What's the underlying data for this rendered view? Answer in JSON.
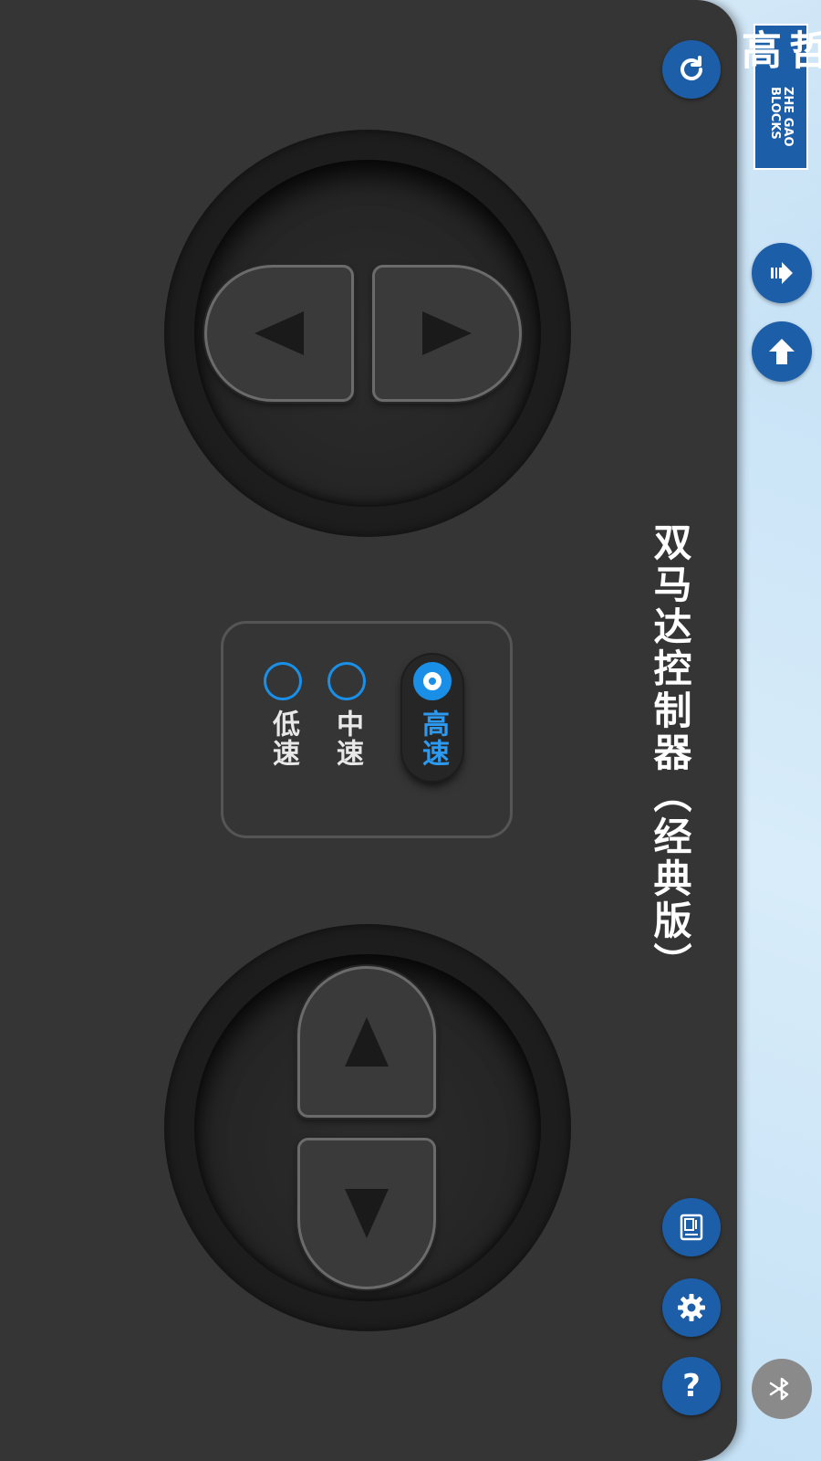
{
  "title": "双马达控制器（经典版）",
  "logo": {
    "cn": "哲高",
    "en": "ZHE GAO BLOCKS"
  },
  "speed": {
    "options": [
      {
        "label": "高速",
        "selected": true
      },
      {
        "label": "中速",
        "selected": false
      },
      {
        "label": "低速",
        "selected": false
      }
    ]
  },
  "help_label": "?",
  "colors": {
    "panel": "#353535",
    "accent": "#1a8fe8",
    "icon_button": "#1d5ea8",
    "bluetooth_button": "#8a8a8a"
  },
  "icons": {
    "refresh": "refresh-icon",
    "card": "device-card-icon",
    "settings": "gear-icon",
    "help": "question-icon",
    "exit": "exit-arrow-icon",
    "upload": "upload-arrow-icon",
    "bluetooth": "bluetooth-icon"
  }
}
